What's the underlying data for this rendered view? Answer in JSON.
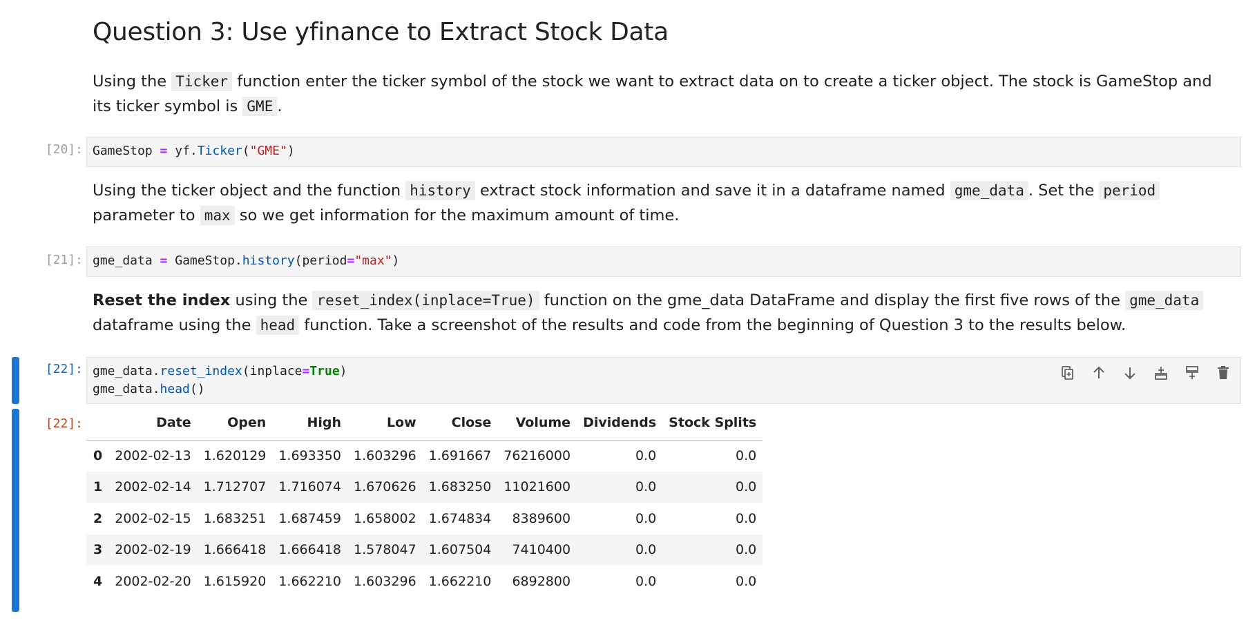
{
  "heading": "Question 3: Use yfinance to Extract Stock Data",
  "md1": {
    "t1": "Using the ",
    "c1": "Ticker",
    "t2": " function enter the ticker symbol of the stock we want to extract data on to create a ticker object. The stock is GameStop and its ticker symbol is ",
    "c2": "GME",
    "t3": "."
  },
  "cell20": {
    "prompt": "[20]:",
    "tokens": [
      "GameStop",
      " ",
      "=",
      " yf.",
      "Ticker",
      "(",
      "\"GME\"",
      ")"
    ]
  },
  "md2": {
    "t1": "Using the ticker object and the function ",
    "c1": "history",
    "t2": " extract stock information and save it in a dataframe named ",
    "c2": "gme_data",
    "t3": ". Set the ",
    "c3": "period",
    "t4": " parameter to ",
    "c4": "max",
    "t5": " so we get information for the maximum amount of time."
  },
  "cell21": {
    "prompt": "[21]:",
    "tokens": [
      "gme_data",
      " ",
      "=",
      " GameStop.",
      "history",
      "(period",
      "=",
      "\"max\"",
      ")"
    ]
  },
  "md3": {
    "b1": "Reset the index",
    "t1": " using the ",
    "c1": "reset_index(inplace=True)",
    "t2": " function on the gme_data DataFrame and display the first five rows of the ",
    "c2": "gme_data",
    "t3": " dataframe using the ",
    "c3": "head",
    "t4": " function. Take a screenshot of the results and code from the beginning of Question 3 to the results below."
  },
  "cell22": {
    "prompt": "[22]:",
    "line1": [
      "gme_data.",
      "reset_index",
      "(inplace",
      "=",
      "True",
      ")"
    ],
    "line2": [
      "gme_data.",
      "head",
      "()"
    ]
  },
  "toolbar": [
    "duplicate-icon",
    "move-up-icon",
    "move-down-icon",
    "insert-below-icon",
    "insert-above-icon",
    "delete-icon"
  ],
  "output": {
    "prompt": "[22]:",
    "columns": [
      "",
      "Date",
      "Open",
      "High",
      "Low",
      "Close",
      "Volume",
      "Dividends",
      "Stock Splits"
    ],
    "rows": [
      [
        "0",
        "2002-02-13",
        "1.620129",
        "1.693350",
        "1.603296",
        "1.691667",
        "76216000",
        "0.0",
        "0.0"
      ],
      [
        "1",
        "2002-02-14",
        "1.712707",
        "1.716074",
        "1.670626",
        "1.683250",
        "11021600",
        "0.0",
        "0.0"
      ],
      [
        "2",
        "2002-02-15",
        "1.683251",
        "1.687459",
        "1.658002",
        "1.674834",
        "8389600",
        "0.0",
        "0.0"
      ],
      [
        "3",
        "2002-02-19",
        "1.666418",
        "1.666418",
        "1.578047",
        "1.607504",
        "7410400",
        "0.0",
        "0.0"
      ],
      [
        "4",
        "2002-02-20",
        "1.615920",
        "1.662210",
        "1.603296",
        "1.662210",
        "6892800",
        "0.0",
        "0.0"
      ]
    ]
  },
  "colors": {
    "active_bar": "#1976d2",
    "prompt_active": "#1565c0",
    "prompt_out": "#c0461d"
  }
}
